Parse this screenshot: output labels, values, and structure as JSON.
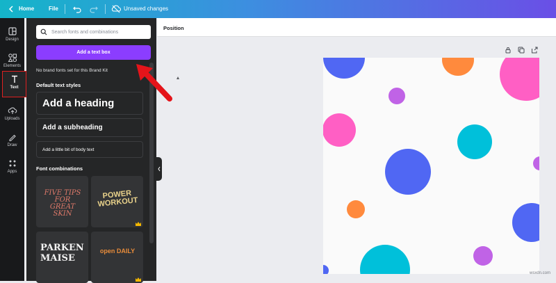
{
  "topbar": {
    "home_label": "Home",
    "file_label": "File",
    "status_label": "Unsaved changes",
    "back_icon": "chevron-left-icon",
    "undo_icon": "undo-icon",
    "redo_icon": "redo-icon",
    "cloud_icon": "cloud-slash-icon"
  },
  "rail": {
    "items": [
      {
        "label": "Design",
        "icon": "design-icon"
      },
      {
        "label": "Elements",
        "icon": "elements-icon"
      },
      {
        "label": "Text",
        "icon": "text-icon",
        "active": true
      },
      {
        "label": "Uploads",
        "icon": "upload-icon"
      },
      {
        "label": "Draw",
        "icon": "draw-icon"
      },
      {
        "label": "Apps",
        "icon": "apps-icon"
      }
    ]
  },
  "panel": {
    "search_placeholder": "Search fonts and combinations",
    "add_text_box": "Add a text box",
    "no_brand": "No brand fonts set for this Brand Kit",
    "default_styles_heading": "Default text styles",
    "heading_sample": "Add a heading",
    "subheading_sample": "Add a subheading",
    "body_sample": "Add a little bit of body text",
    "font_combinations_heading": "Font combinations",
    "combos": [
      {
        "text": "FIVE TIPS FOR GREAT SKIN",
        "color": "#e07a6a"
      },
      {
        "text": "POWER WORKOUT",
        "color": "#e8d18a"
      },
      {
        "text": "PARKEN MAISE",
        "color": "#f2f2f2"
      },
      {
        "text": "open DAILY",
        "color": "#e98c3a"
      }
    ]
  },
  "canvas": {
    "position_label": "Position",
    "lock_icon": "lock-icon",
    "duplicate_icon": "duplicate-icon",
    "share_icon": "share-icon"
  },
  "colors": {
    "accent": "#8b3dff",
    "blue": "#5067f3",
    "pink": "#ff5fc4",
    "orange": "#ff8a3d",
    "purple": "#c063e6",
    "cyan": "#00c0da",
    "highlight": "#e02020"
  },
  "watermark": "wsxdn.com"
}
